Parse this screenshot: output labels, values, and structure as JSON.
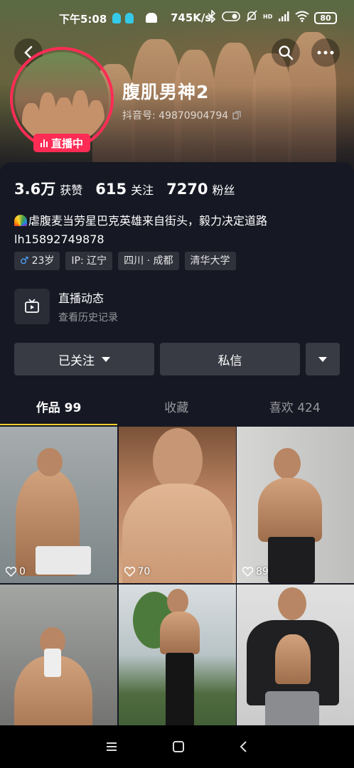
{
  "status_bar": {
    "time": "下午5:08",
    "net_speed": "745K/s",
    "signal_label": "HD",
    "battery": "80"
  },
  "profile": {
    "name": "腹肌男神2",
    "uid_label": "抖音号: 49870904794",
    "live_badge": "直播中",
    "stats": [
      {
        "value": "3.6万",
        "label": "获赞"
      },
      {
        "value": "615",
        "label": "关注"
      },
      {
        "value": "7270",
        "label": "粉丝"
      }
    ],
    "bio_line1": "虐腹麦当劳星巴克英雄来自街头，毅力决定道路",
    "bio_line2": "lh15892749878",
    "tags": {
      "age": "23岁",
      "ip": "IP: 辽宁",
      "location": "四川 · 成都",
      "school": "清华大学"
    },
    "live_dynamic": {
      "title": "直播动态",
      "subtitle": "查看历史记录"
    }
  },
  "actions": {
    "followed": "已关注",
    "message": "私信"
  },
  "tabs": [
    {
      "label": "作品 99",
      "active": true
    },
    {
      "label": "收藏",
      "active": false
    },
    {
      "label": "喜欢 424",
      "active": false
    }
  ],
  "videos": [
    {
      "likes": "0",
      "bg": "#9aa3a6"
    },
    {
      "likes": "70",
      "bg": "#6b4a36"
    },
    {
      "likes": "89",
      "bg": "#c9c9c7"
    },
    {
      "likes": "",
      "bg": "#8e8f8d"
    },
    {
      "likes": "",
      "bg": "#5f7c58"
    },
    {
      "likes": "",
      "bg": "#cfcfcf"
    }
  ],
  "colors": {
    "accent": "#fe2c55",
    "tab_indicator": "#facf2c",
    "background": "#161823"
  }
}
